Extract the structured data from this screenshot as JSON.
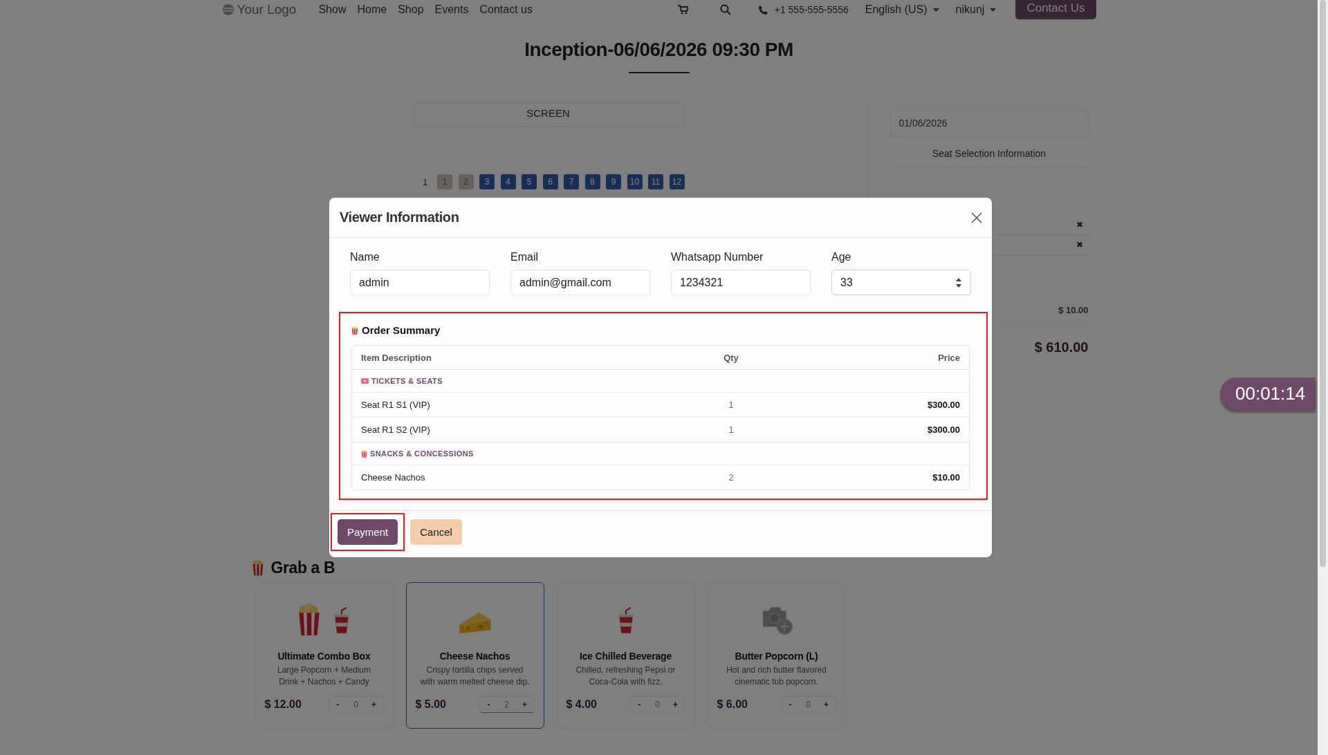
{
  "nav": {
    "logo": "Your Logo",
    "links": [
      {
        "label": "Show"
      },
      {
        "label": "Home"
      },
      {
        "label": "Shop"
      },
      {
        "label": "Events"
      },
      {
        "label": "Contact us"
      }
    ],
    "phone": "+1 555-555-5556",
    "language": "English (US)",
    "user": "nikunj",
    "contact_button": "Contact Us"
  },
  "title": "Inception-06/06/2026 09:30 PM",
  "screen_label": "SCREEN",
  "seat_row": {
    "label": "1",
    "seats": [
      {
        "number": "1",
        "reserved": true
      },
      {
        "number": "2",
        "reserved": true
      },
      {
        "number": "3",
        "reserved": false
      },
      {
        "number": "4",
        "reserved": false
      },
      {
        "number": "5",
        "reserved": false
      },
      {
        "number": "6",
        "reserved": false
      },
      {
        "number": "7",
        "reserved": false
      },
      {
        "number": "8",
        "reserved": false
      },
      {
        "number": "9",
        "reserved": false
      },
      {
        "number": "10",
        "reserved": false
      },
      {
        "number": "11",
        "reserved": false
      },
      {
        "number": "12",
        "reserved": false
      }
    ]
  },
  "side_panel": {
    "date": "01/06/2026",
    "heading": "Seat Selection Information",
    "remove_marks": [
      "✖",
      "✖"
    ],
    "snack_total": "$ 10.00",
    "grand_total": "$ 610.00"
  },
  "timer": "00:01:14",
  "snacks_section": {
    "heading": "Grab a B",
    "items": [
      {
        "kind": "combo",
        "name": "Ultimate Combo Box",
        "description": "Large Popcorn + Medium Drink + Nachos + Candy",
        "price": "$ 12.00",
        "decrease": "-",
        "quantity": "0",
        "increase": "+",
        "selected": false
      },
      {
        "kind": "cheese",
        "name": "Cheese Nachos",
        "description": "Crispy tortilla chips served with warm melted cheese dip.",
        "price": "$ 5.00",
        "decrease": "-",
        "quantity": "2",
        "increase": "+",
        "selected": true
      },
      {
        "kind": "drink",
        "name": "Ice Chilled Beverage",
        "description": "Chilled, refreshing Pepsi or Coca-Cola with fizz.",
        "price": "$ 4.00",
        "decrease": "-",
        "quantity": "0",
        "increase": "+",
        "selected": false
      },
      {
        "kind": "no-image",
        "name": "Butter Popcorn (L)",
        "description": "Hot and rich butter flavored cinematic tub popcorn.",
        "price": "$ 6.00",
        "decrease": "-",
        "quantity": "0",
        "increase": "+",
        "selected": false
      }
    ]
  },
  "modal": {
    "title": "Viewer Information",
    "fields": [
      {
        "label": "Name",
        "value": "admin",
        "kind": "text"
      },
      {
        "label": "Email",
        "value": "admin@gmail.com",
        "kind": "text"
      },
      {
        "label": "Whatsapp Number",
        "value": "1234321",
        "kind": "text"
      },
      {
        "label": "Age",
        "value": "33",
        "kind": "number"
      }
    ],
    "order_summary": {
      "title": "Order Summary",
      "highlighted": true,
      "columns": [
        "Item Description",
        "Qty",
        "Price"
      ],
      "groups": [
        {
          "kind": "tickets",
          "title": "TICKETS & SEATS",
          "rows": [
            {
              "item": "Seat R1 S1 (VIP)",
              "qty": "1",
              "price": "$300.00"
            },
            {
              "item": "Seat R1 S2 (VIP)",
              "qty": "1",
              "price": "$300.00"
            }
          ]
        },
        {
          "kind": "snacks",
          "title": "SNACKS & CONCESSIONS",
          "rows": [
            {
              "item": "Cheese Nachos",
              "qty": "2",
              "price": "$10.00"
            }
          ]
        }
      ]
    },
    "buttons": [
      {
        "label": "Payment",
        "kind": "primary",
        "highlighted": true
      },
      {
        "label": "Cancel",
        "kind": "secondary",
        "highlighted": false
      }
    ]
  }
}
